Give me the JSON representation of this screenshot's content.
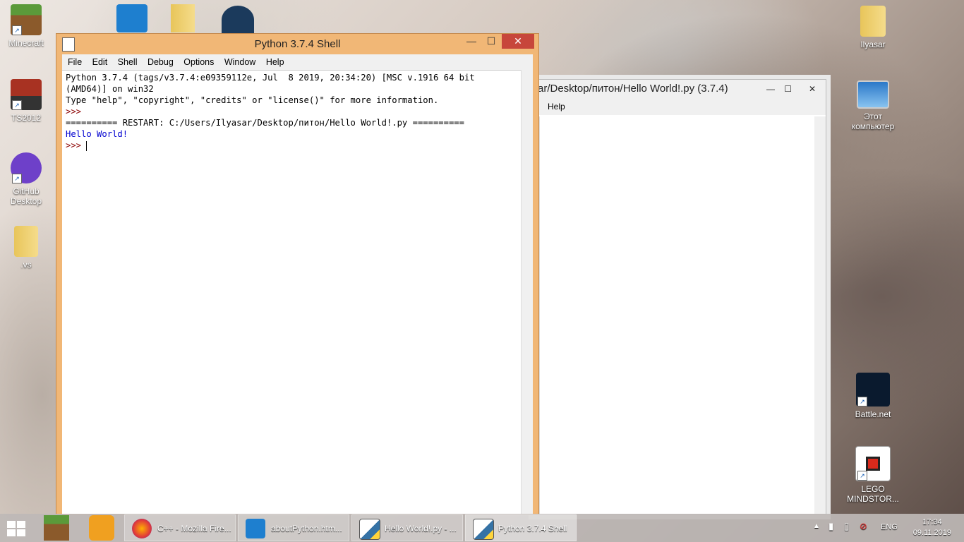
{
  "desktop": {
    "left_icons": [
      {
        "label": "Minecraft",
        "icon": "minecraft-icon"
      },
      {
        "label": "TS2012",
        "icon": "train-icon"
      },
      {
        "label": "GitHub\nDesktop",
        "icon": "github-icon"
      },
      {
        "label": ".vs",
        "icon": "folder-icon"
      }
    ],
    "right_icons": [
      {
        "label": "Ilyasar",
        "icon": "user-folder-icon"
      },
      {
        "label": "Этот\nкомпьютер",
        "icon": "computer-icon"
      },
      {
        "label": "Battle.net",
        "icon": "battlenet-icon"
      },
      {
        "label": "LEGO\nMINDSTOR...",
        "icon": "lego-icon"
      }
    ]
  },
  "back_window": {
    "title": "ar/Desktop/питон/Hello World!.py (3.7.4)",
    "menu": [
      "Help"
    ],
    "minimize": "—",
    "maximize": "☐",
    "close": "✕"
  },
  "shell_window": {
    "title": "Python 3.7.4 Shell",
    "minimize": "—",
    "maximize": "☐",
    "close": "✕",
    "menu": [
      "File",
      "Edit",
      "Shell",
      "Debug",
      "Options",
      "Window",
      "Help"
    ],
    "lines": {
      "l1": "Python 3.7.4 (tags/v3.7.4:e09359112e, Jul  8 2019, 20:34:20) [MSC v.1916 64 bit",
      "l2": "(AMD64)] on win32",
      "l3": "Type \"help\", \"copyright\", \"credits\" or \"license()\" for more information.",
      "l4": ">>> ",
      "l5": "========== RESTART: C:/Users/Ilyasar/Desktop/питон/Hello World!.py ==========",
      "l6": "Hello World!",
      "l7": ">>> "
    }
  },
  "taskbar": {
    "items": [
      {
        "label": "C++ - Mozilla Fire...",
        "icon": "firefox-icon"
      },
      {
        "label": "aboutPython.htm...",
        "icon": "vscode-icon"
      },
      {
        "label": "Hello World!.py - ...",
        "icon": "python-idle-icon"
      },
      {
        "label": "Python 3.7.4 Shell",
        "icon": "python-idle-icon"
      }
    ],
    "lang": "ENG",
    "time": "17:34",
    "date": "09.11.2019"
  },
  "colors": {
    "shell_frame": "#f1b776",
    "close_red": "#c7463b",
    "stdout_blue": "#0000d0"
  }
}
